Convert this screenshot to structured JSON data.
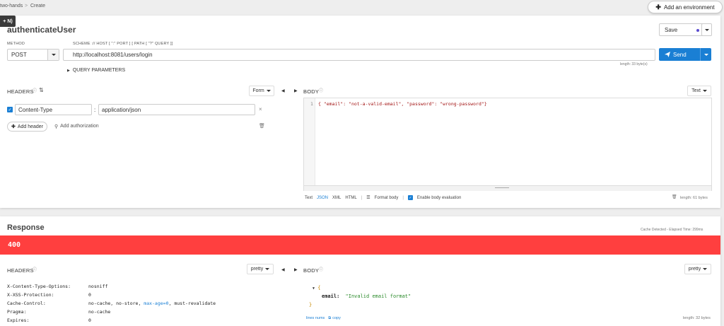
{
  "breadcrumb": {
    "project": "two-hands",
    "separator": ">",
    "current": "Create"
  },
  "shortcut_tooltip": "+ N)",
  "add_environment": "Add an environment",
  "request": {
    "title": "authenticateUser",
    "save_label": "Save",
    "method_label": "METHOD",
    "method_value": "POST",
    "url_label": "SCHEME :// HOST [ \":\" PORT ] [ PATH [ \"?\" QUERY ]]",
    "url_value": "http://localhost:8081/users/login",
    "url_length": "length: 33 byte(s)",
    "send_label": "Send",
    "query_params": "QUERY PARAMETERS",
    "headers_title": "HEADERS",
    "headers_mode": "Form",
    "header_rows": [
      {
        "name": "Content-Type",
        "separator": ":",
        "value": "application/json",
        "enabled": true
      }
    ],
    "add_header": "Add header",
    "add_authorization": "Add authorization",
    "body_title": "BODY",
    "body_mode": "Text",
    "body_line_number": "1",
    "body_text": "{ \"email\": \"not-a-valid-email\", \"password\": \"wrong-password\"}",
    "body_formats": [
      "Text",
      "JSON",
      "XML",
      "HTML"
    ],
    "body_format_active": "JSON",
    "format_body": "Format body",
    "enable_eval": "Enable body evaluation",
    "body_length": "length: 61 bytes"
  },
  "response": {
    "title": "Response",
    "cache_info": "Cache Detected - Elapsed Time: 299ms",
    "status_code": "400",
    "status_color": "#ff3f3f",
    "headers_title": "HEADERS",
    "headers_mode": "pretty",
    "headers": [
      {
        "name": "X-Content-Type-Options:",
        "value": "nosniff"
      },
      {
        "name": "X-XSS-Protection:",
        "value": "0"
      },
      {
        "name": "Cache-Control:",
        "value_pre": "no-cache, no-store, ",
        "value_link": "max-age=0",
        "value_post": ", must-revalidate"
      },
      {
        "name": "Pragma:",
        "value": "no-cache"
      },
      {
        "name": "Expires:",
        "value": "0"
      }
    ],
    "body_title": "BODY",
    "body_mode": "pretty",
    "body_open": "{",
    "body_key": "email:",
    "body_value": "\"Invalid email format\"",
    "body_close": "}",
    "lines_nums": "lines nums",
    "copy": "copy",
    "body_length": "length: 32 bytes"
  },
  "colors": {
    "accent": "#1a7fd4",
    "error": "#ff3f3f",
    "json_string": "#c41a16",
    "json_value_green": "#2a8a2a"
  }
}
